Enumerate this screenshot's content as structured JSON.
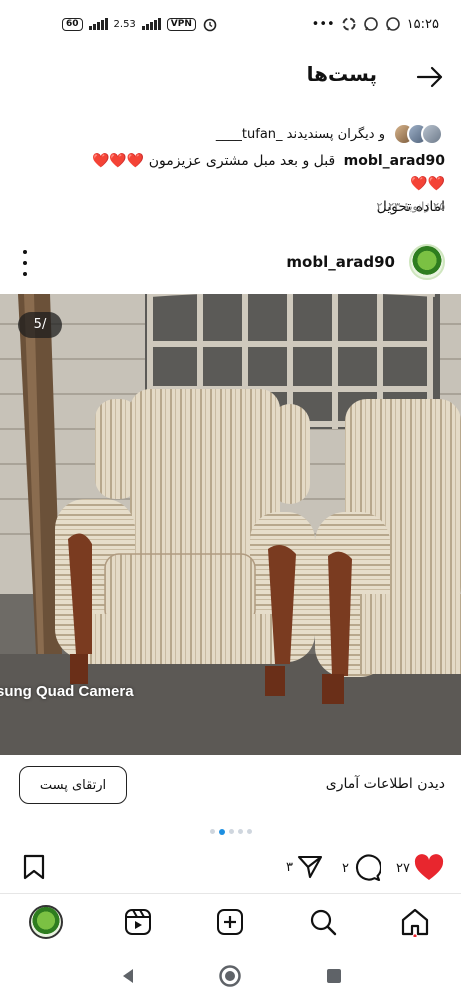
{
  "status_bar": {
    "time": "۱۵:۲۵",
    "network_badge": "60",
    "data_speed": "2.53",
    "vpn_label": "VPN",
    "more_label": "•••"
  },
  "header": {
    "title": "پست‌ها"
  },
  "caption": {
    "likes_text": "و دیگران پسندیدند _tufan____",
    "author": "mobl_arad90",
    "text": "قبل و بعد مبل مشتری عزیزمون",
    "hearts": "❤️❤️❤️❤️❤️",
    "text_line2": "اماده تحویل",
    "date": "۲۵ ژانویهٔ ۲۰۲۳"
  },
  "post": {
    "username": "mobl_arad90",
    "counter": "5/",
    "watermark": "sung Quad Camera"
  },
  "boost": {
    "button_label": "ارتقای پست",
    "insights_label": "دیدن اطلاعات آماری"
  },
  "carousel": {
    "total": 5,
    "active_index": 1
  },
  "actions": {
    "likes_count": "۲۷",
    "comments_count": "۲",
    "shares_count": "۳"
  },
  "colors": {
    "heart": "#e8262e",
    "active_dot": "#1d8fe1",
    "text": "#111111"
  },
  "icons": {
    "tabs": [
      "profile-avatar",
      "search-icon",
      "add-post-icon",
      "reels-icon",
      "home-icon"
    ]
  }
}
